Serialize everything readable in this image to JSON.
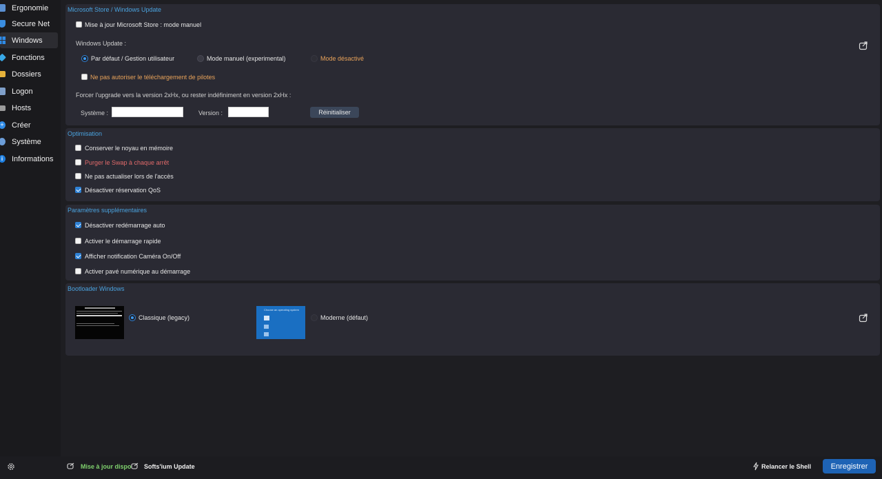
{
  "sidebar": {
    "items": [
      {
        "label": "Ergonomie",
        "icon": "ergonomics-icon",
        "color": "#5a8fd1"
      },
      {
        "label": "Secure Net",
        "icon": "shield-icon",
        "color": "#3a8de0"
      },
      {
        "label": "Windows",
        "icon": "windows-icon",
        "color": "#2f8be6"
      },
      {
        "label": "Fonctions",
        "icon": "functions-icon",
        "color": "#38a9e8"
      },
      {
        "label": "Dossiers",
        "icon": "folder-icon",
        "color": "#e7b33b"
      },
      {
        "label": "Logon",
        "icon": "user-icon",
        "color": "#7f9fc9"
      },
      {
        "label": "Hosts",
        "icon": "hosts-icon",
        "color": "#9b9b9b"
      },
      {
        "label": "Créer",
        "icon": "plus-icon",
        "color": "#2f8be6"
      },
      {
        "label": "Système",
        "icon": "gear-icon",
        "color": "#6c9dd8"
      },
      {
        "label": "Informations",
        "icon": "info-icon",
        "color": "#1e7fe0"
      }
    ],
    "active_index": 2
  },
  "store_panel": {
    "title": "Microsoft Store / Windows Update",
    "store_manual_label": "Mise à jour Microsoft Store : mode manuel",
    "store_manual_checked": false,
    "wu_label": "Windows Update :",
    "wu_options": [
      "Par défaut / Gestion utilisateur",
      "Mode manuel (experimental)",
      "Mode désactivé"
    ],
    "wu_selected": 0,
    "drivers_label": "Ne pas autoriser le téléchargement de pilotes",
    "drivers_checked": false,
    "force_label": "Forcer l'upgrade vers la version 2xHx, ou rester indéfiniment en version 2xHx :",
    "system_label": "Système :",
    "system_value": "",
    "version_label": "Version :",
    "version_value": "",
    "reset_label": "Réinitialiser"
  },
  "opt_panel": {
    "title": "Optimisation",
    "items": [
      {
        "label": "Conserver le noyau en mémoire",
        "checked": false
      },
      {
        "label": "Purger le Swap à chaque arrêt",
        "checked": false
      },
      {
        "label": "Ne pas actualiser lors de l'accès",
        "checked": false
      },
      {
        "label": "Désactiver réservation QoS",
        "checked": true
      }
    ]
  },
  "extra_panel": {
    "title": "Paramètres supplémentaires",
    "items": [
      {
        "label": "Désactiver redémarrage auto",
        "checked": true
      },
      {
        "label": "Activer le démarrage rapide",
        "checked": false
      },
      {
        "label": "Afficher notification Caméra On/Off",
        "checked": true
      },
      {
        "label": "Activer pavé numérique au démarrage",
        "checked": false
      }
    ]
  },
  "boot_panel": {
    "title": "Bootloader Windows",
    "legacy_label": "Classique (legacy)",
    "modern_label": "Moderne (défaut)",
    "selected": "legacy",
    "modern_thumb_heading": "Choose an operating system"
  },
  "bottom": {
    "update_device_label": "Mise à jour dispo",
    "softsium_update_label": "Softs'ium Update",
    "restart_shell_label": "Relancer le Shell",
    "save_label": "Enregistrer"
  },
  "colors": {
    "accent": "#4aa3df",
    "warn": "#e9a35a",
    "danger": "#e06a6a",
    "save_button": "#1e63b5",
    "update_green": "#7fd16d"
  }
}
